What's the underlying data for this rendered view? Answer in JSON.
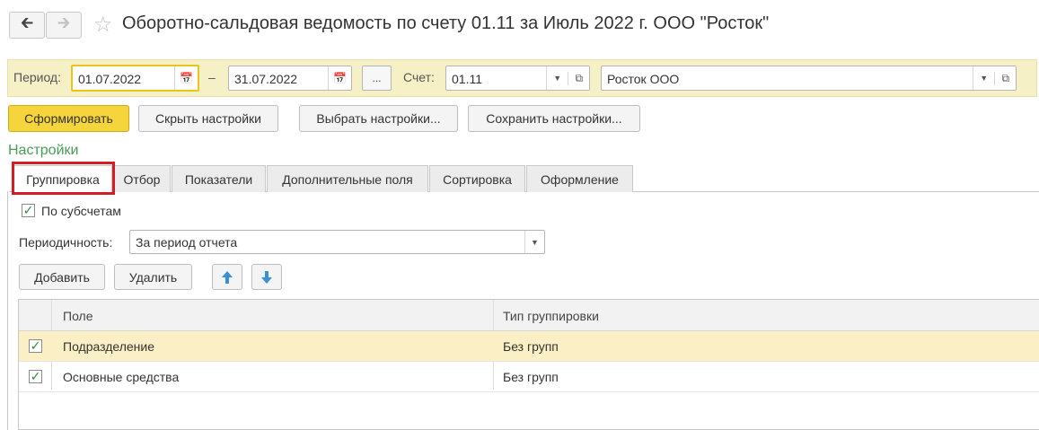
{
  "header": {
    "back_icon": "arrow-left-icon",
    "forward_icon": "arrow-right-icon",
    "favorite_icon": "star-icon",
    "title": "Оборотно-сальдовая ведомость по счету 01.11 за Июль 2022 г. ООО \"Росток\""
  },
  "toolbar": {
    "period_label": "Период:",
    "date_from": "01.07.2022",
    "dash": "–",
    "date_to": "31.07.2022",
    "ellipsis": "...",
    "account_label": "Счет:",
    "account": "01.11",
    "organization": "Росток ООО"
  },
  "actions": {
    "generate": "Сформировать",
    "hide_settings": "Скрыть настройки",
    "choose_settings": "Выбрать настройки...",
    "save_settings": "Сохранить настройки..."
  },
  "settings_title": "Настройки",
  "tabs": [
    {
      "label": "Группировка",
      "active": true
    },
    {
      "label": "Отбор"
    },
    {
      "label": "Показатели"
    },
    {
      "label": "Дополнительные поля"
    },
    {
      "label": "Сортировка"
    },
    {
      "label": "Оформление"
    }
  ],
  "grouping": {
    "by_subaccounts_label": "По субсчетам",
    "by_subaccounts_checked": true,
    "periodicity_label": "Периодичность:",
    "periodicity_value": "За период отчета",
    "add_button": "Добавить",
    "delete_button": "Удалить",
    "move_up_icon": "arrow-up-icon",
    "move_down_icon": "arrow-down-icon"
  },
  "table": {
    "columns": [
      "Поле",
      "Тип группировки"
    ],
    "rows": [
      {
        "checked": true,
        "field": "Подразделение",
        "type": "Без групп",
        "selected": true
      },
      {
        "checked": true,
        "field": "Основные средства",
        "type": "Без групп",
        "selected": false
      }
    ]
  },
  "colors": {
    "accent_yellow": "#f5d53b",
    "panel_yellow": "#f6f0c6",
    "settings_green": "#4c9a59",
    "highlight_red": "#d41c24",
    "selected_row": "#fbefc5"
  }
}
